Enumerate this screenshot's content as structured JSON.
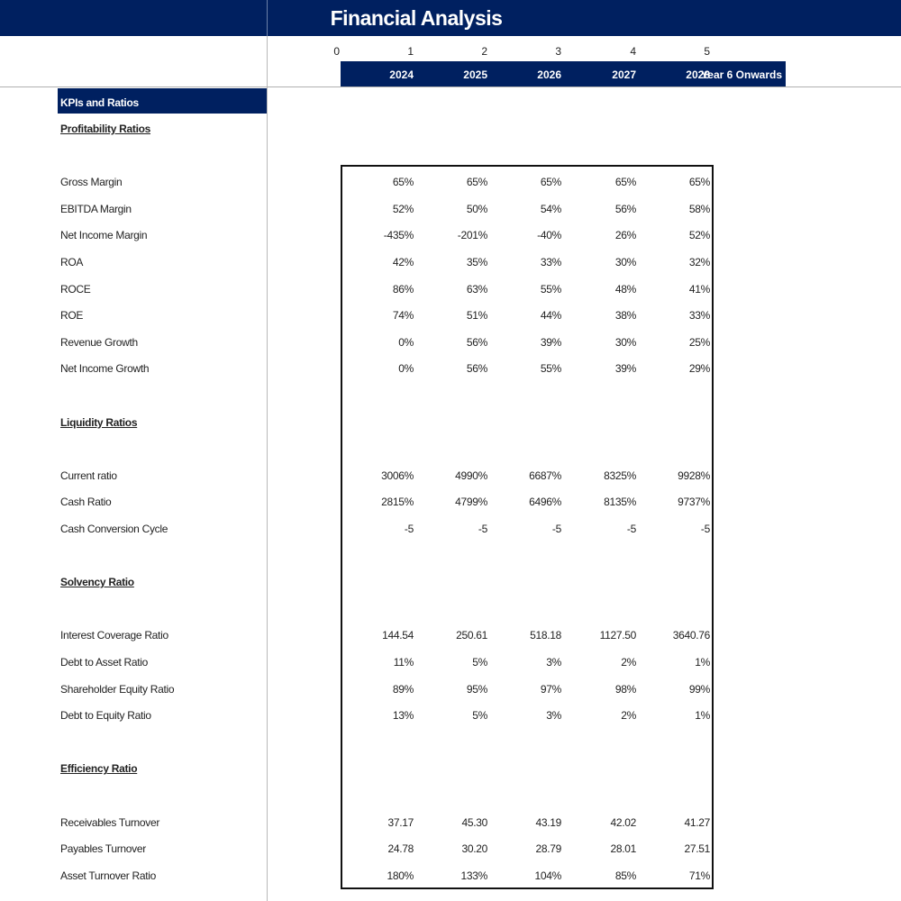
{
  "title": "Financial Analysis",
  "period_indices": [
    "0",
    "1",
    "2",
    "3",
    "4",
    "5"
  ],
  "years": [
    "2024",
    "2025",
    "2026",
    "2027",
    "2028",
    "Year 6 Onwards"
  ],
  "kpi_header": "KPIs and Ratios",
  "colors": {
    "header_navy": "#002060"
  },
  "sections": [
    {
      "title": "Profitability Ratios",
      "rows": [
        {
          "label": "Gross Margin",
          "values": [
            "65%",
            "65%",
            "65%",
            "65%",
            "65%"
          ]
        },
        {
          "label": "EBITDA Margin",
          "values": [
            "52%",
            "50%",
            "54%",
            "56%",
            "58%"
          ]
        },
        {
          "label": "Net Income Margin",
          "values": [
            "-435%",
            "-201%",
            "-40%",
            "26%",
            "52%"
          ]
        },
        {
          "label": "ROA",
          "values": [
            "42%",
            "35%",
            "33%",
            "30%",
            "32%"
          ]
        },
        {
          "label": "ROCE",
          "values": [
            "86%",
            "63%",
            "55%",
            "48%",
            "41%"
          ]
        },
        {
          "label": "ROE",
          "values": [
            "74%",
            "51%",
            "44%",
            "38%",
            "33%"
          ]
        },
        {
          "label": "Revenue Growth",
          "values": [
            "0%",
            "56%",
            "39%",
            "30%",
            "25%"
          ]
        },
        {
          "label": "Net Income Growth",
          "values": [
            "0%",
            "56%",
            "55%",
            "39%",
            "29%"
          ]
        }
      ]
    },
    {
      "title": "Liquidity Ratios",
      "rows": [
        {
          "label": "Current ratio",
          "values": [
            "3006%",
            "4990%",
            "6687%",
            "8325%",
            "9928%"
          ]
        },
        {
          "label": "Cash Ratio",
          "values": [
            "2815%",
            "4799%",
            "6496%",
            "8135%",
            "9737%"
          ]
        },
        {
          "label": "Cash Conversion Cycle",
          "values": [
            "-5",
            "-5",
            "-5",
            "-5",
            "-5"
          ]
        }
      ]
    },
    {
      "title": "Solvency Ratio",
      "rows": [
        {
          "label": "Interest Coverage Ratio",
          "values": [
            "144.54",
            "250.61",
            "518.18",
            "1127.50",
            "3640.76"
          ]
        },
        {
          "label": "Debt to Asset Ratio",
          "values": [
            "11%",
            "5%",
            "3%",
            "2%",
            "1%"
          ]
        },
        {
          "label": "Shareholder Equity Ratio",
          "values": [
            "89%",
            "95%",
            "97%",
            "98%",
            "99%"
          ]
        },
        {
          "label": "Debt to Equity Ratio",
          "values": [
            "13%",
            "5%",
            "3%",
            "2%",
            "1%"
          ]
        }
      ]
    },
    {
      "title": "Efficiency Ratio",
      "rows": [
        {
          "label": "Receivables Turnover",
          "values": [
            "37.17",
            "45.30",
            "43.19",
            "42.02",
            "41.27"
          ]
        },
        {
          "label": "Payables Turnover",
          "values": [
            "24.78",
            "30.20",
            "28.79",
            "28.01",
            "27.51"
          ]
        },
        {
          "label": "Asset Turnover Ratio",
          "values": [
            "180%",
            "133%",
            "104%",
            "85%",
            "71%"
          ]
        }
      ]
    }
  ]
}
